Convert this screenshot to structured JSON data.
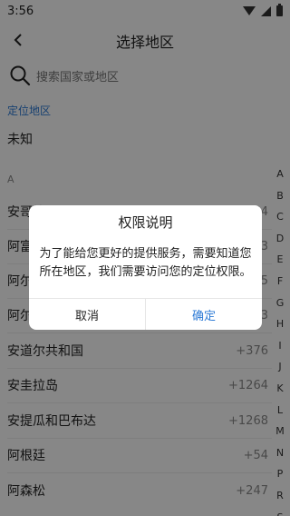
{
  "status": {
    "time": "3:56"
  },
  "header": {
    "title": "选择地区"
  },
  "search": {
    "placeholder": "搜索国家或地区"
  },
  "location": {
    "label": "定位地区",
    "value": "未知"
  },
  "section_a": "A",
  "countries": [
    {
      "name": "安哥拉",
      "code": "+244"
    },
    {
      "name": "阿富汗",
      "code": "+93"
    },
    {
      "name": "阿尔巴尼亚",
      "code": "+355"
    },
    {
      "name": "阿尔及利亚",
      "code": "+213"
    },
    {
      "name": "安道尔共和国",
      "code": "+376"
    },
    {
      "name": "安圭拉岛",
      "code": "+1264"
    },
    {
      "name": "安提瓜和巴布达",
      "code": "+1268"
    },
    {
      "name": "阿根廷",
      "code": "+54"
    },
    {
      "name": "阿森松",
      "code": "+247"
    }
  ],
  "index_letters": [
    "A",
    "B",
    "C",
    "D",
    "E",
    "F",
    "G",
    "H",
    "I",
    "J",
    "K",
    "L",
    "M",
    "N",
    "P",
    "R",
    "S"
  ],
  "dialog": {
    "title": "权限说明",
    "message": "为了能给您更好的提供服务，需要知道您所在地区，我们需要访问您的定位权限。",
    "cancel": "取消",
    "confirm": "确定"
  },
  "colors": {
    "accent": "#2e7bd6",
    "overlay": "rgba(0,0,0,0.47)"
  }
}
